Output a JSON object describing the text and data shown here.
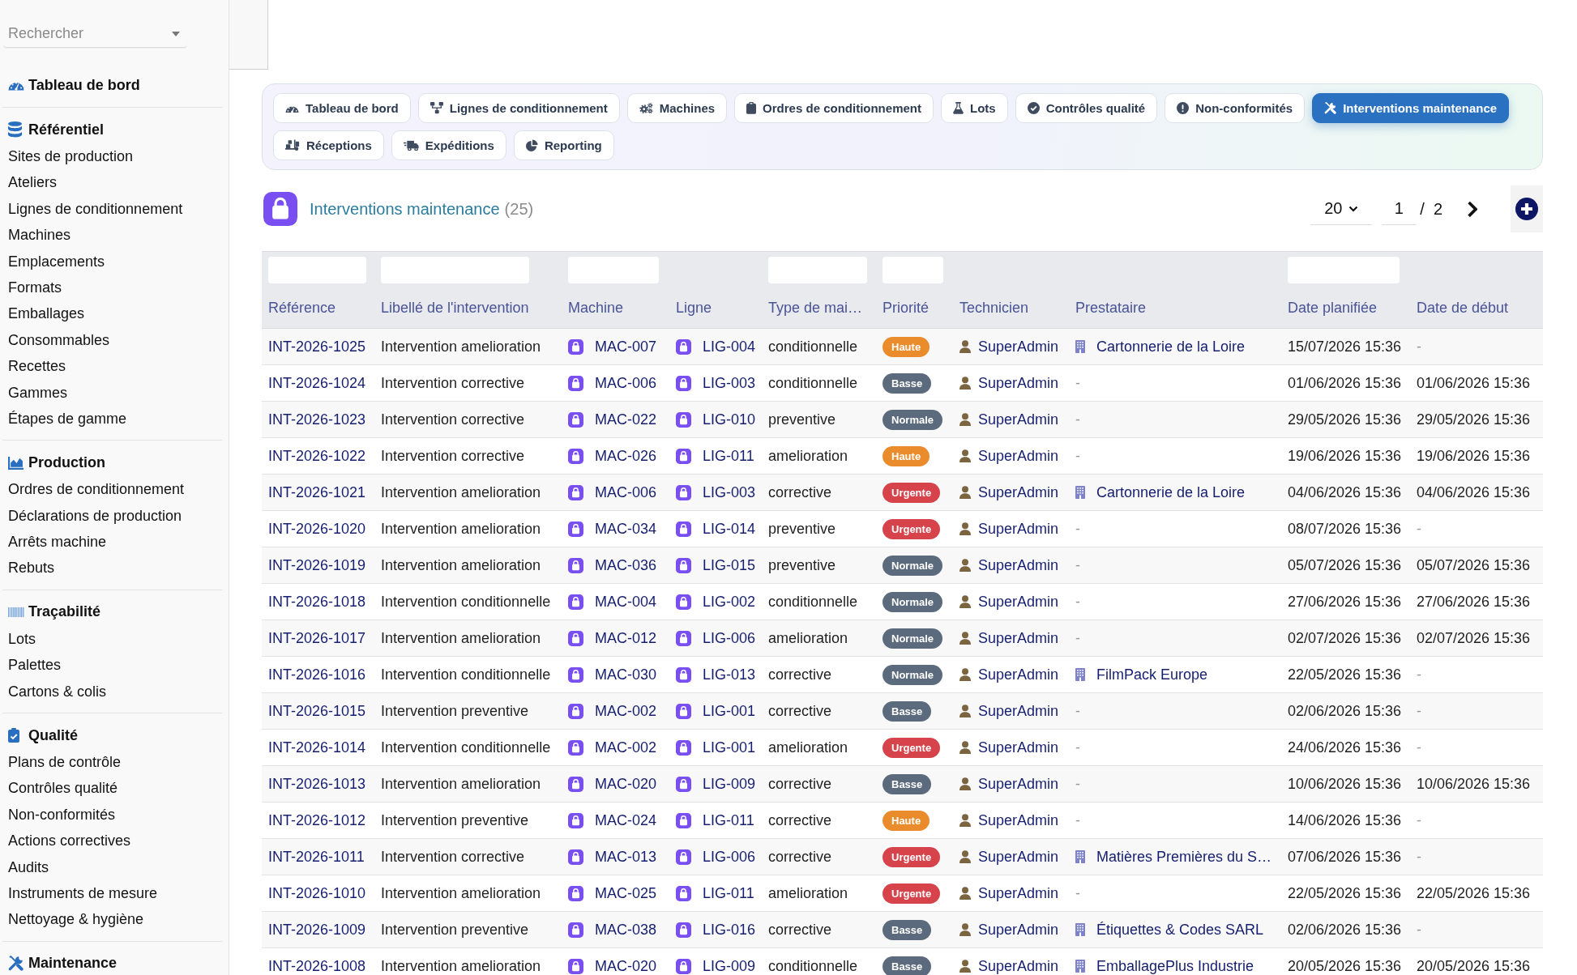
{
  "sidebar": {
    "search": {
      "placeholder": "Rechercher"
    },
    "sections": [
      {
        "title": "Tableau de bord"
      },
      {
        "title": "Référentiel",
        "items": [
          "Sites de production",
          "Ateliers",
          "Lignes de conditionnement",
          "Machines",
          "Emplacements",
          "Formats",
          "Emballages",
          "Consommables",
          "Recettes",
          "Gammes",
          "Étapes de gamme"
        ]
      },
      {
        "title": "Production",
        "items": [
          "Ordres de conditionnement",
          "Déclarations de production",
          "Arrêts machine",
          "Rebuts"
        ]
      },
      {
        "title": "Traçabilité",
        "items": [
          "Lots",
          "Palettes",
          "Cartons & colis"
        ]
      },
      {
        "title": "Qualité",
        "items": [
          "Plans de contrôle",
          "Contrôles qualité",
          "Non-conformités",
          "Actions correctives",
          "Audits",
          "Instruments de mesure",
          "Nettoyage & hygiène"
        ]
      },
      {
        "title": "Maintenance"
      }
    ]
  },
  "nav_tabs": [
    {
      "label": "Tableau de bord",
      "selected": false
    },
    {
      "label": "Lignes de conditionnement",
      "selected": false
    },
    {
      "label": "Machines",
      "selected": false
    },
    {
      "label": "Ordres de conditionnement",
      "selected": false
    },
    {
      "label": "Lots",
      "selected": false
    },
    {
      "label": "Contrôles qualité",
      "selected": false
    },
    {
      "label": "Non-conformités",
      "selected": false
    },
    {
      "label": "Interventions maintenance",
      "selected": true
    },
    {
      "label": "Réceptions",
      "selected": false
    },
    {
      "label": "Expéditions",
      "selected": false
    },
    {
      "label": "Reporting",
      "selected": false
    }
  ],
  "page": {
    "title": "Interventions maintenance",
    "count": "(25)"
  },
  "pagination": {
    "page_size": "20",
    "page": "1",
    "separator": "/",
    "page_count": "2"
  },
  "table": {
    "columns": [
      {
        "label": "Référence",
        "filter": true
      },
      {
        "label": "Libellé de l'intervention",
        "filter": true
      },
      {
        "label": "Machine",
        "filter": true
      },
      {
        "label": "Ligne",
        "filter": false
      },
      {
        "label": "Type de mai…",
        "filter": true
      },
      {
        "label": "Priorité",
        "filter": true
      },
      {
        "label": "Technicien",
        "filter": false
      },
      {
        "label": "Prestataire",
        "filter": false
      },
      {
        "label": "Date planifiée",
        "filter": true
      },
      {
        "label": "Date de début",
        "filter": false
      }
    ],
    "rows": [
      {
        "reference": "INT-2026-1025",
        "title": "Intervention amelioration",
        "machine": "MAC-007",
        "line": "LIG-004",
        "type": "conditionnelle",
        "priority": {
          "text": "Haute",
          "color": "#ea8c2c"
        },
        "technician": "SuperAdmin",
        "supplier": {
          "kind": "company",
          "text": "Cartonnerie de la Loire"
        },
        "planned": "15/07/2026 15:36",
        "start": {
          "kind": "empty",
          "text": "-"
        }
      },
      {
        "reference": "INT-2026-1024",
        "title": "Intervention corrective",
        "machine": "MAC-006",
        "line": "LIG-003",
        "type": "conditionnelle",
        "priority": {
          "text": "Basse",
          "color": "#5b6b7d"
        },
        "technician": "SuperAdmin",
        "supplier": {
          "kind": "empty",
          "text": "-"
        },
        "planned": "01/06/2026 15:36",
        "start": {
          "kind": "date",
          "text": "01/06/2026 15:36"
        }
      },
      {
        "reference": "INT-2026-1023",
        "title": "Intervention corrective",
        "machine": "MAC-022",
        "line": "LIG-010",
        "type": "preventive",
        "priority": {
          "text": "Normale",
          "color": "#5b6b7d"
        },
        "technician": "SuperAdmin",
        "supplier": {
          "kind": "empty",
          "text": "-"
        },
        "planned": "29/05/2026 15:36",
        "start": {
          "kind": "date",
          "text": "29/05/2026 15:36"
        }
      },
      {
        "reference": "INT-2026-1022",
        "title": "Intervention corrective",
        "machine": "MAC-026",
        "line": "LIG-011",
        "type": "amelioration",
        "priority": {
          "text": "Haute",
          "color": "#ea8c2c"
        },
        "technician": "SuperAdmin",
        "supplier": {
          "kind": "empty",
          "text": "-"
        },
        "planned": "19/06/2026 15:36",
        "start": {
          "kind": "date",
          "text": "19/06/2026 15:36"
        }
      },
      {
        "reference": "INT-2026-1021",
        "title": "Intervention amelioration",
        "machine": "MAC-006",
        "line": "LIG-003",
        "type": "corrective",
        "priority": {
          "text": "Urgente",
          "color": "#d6434b"
        },
        "technician": "SuperAdmin",
        "supplier": {
          "kind": "company",
          "text": "Cartonnerie de la Loire"
        },
        "planned": "04/06/2026 15:36",
        "start": {
          "kind": "date",
          "text": "04/06/2026 15:36"
        }
      },
      {
        "reference": "INT-2026-1020",
        "title": "Intervention amelioration",
        "machine": "MAC-034",
        "line": "LIG-014",
        "type": "preventive",
        "priority": {
          "text": "Urgente",
          "color": "#d6434b"
        },
        "technician": "SuperAdmin",
        "supplier": {
          "kind": "empty",
          "text": "-"
        },
        "planned": "08/07/2026 15:36",
        "start": {
          "kind": "empty",
          "text": "-"
        }
      },
      {
        "reference": "INT-2026-1019",
        "title": "Intervention amelioration",
        "machine": "MAC-036",
        "line": "LIG-015",
        "type": "preventive",
        "priority": {
          "text": "Normale",
          "color": "#5b6b7d"
        },
        "technician": "SuperAdmin",
        "supplier": {
          "kind": "empty",
          "text": "-"
        },
        "planned": "05/07/2026 15:36",
        "start": {
          "kind": "date",
          "text": "05/07/2026 15:36"
        }
      },
      {
        "reference": "INT-2026-1018",
        "title": "Intervention conditionnelle",
        "machine": "MAC-004",
        "line": "LIG-002",
        "type": "conditionnelle",
        "priority": {
          "text": "Normale",
          "color": "#5b6b7d"
        },
        "technician": "SuperAdmin",
        "supplier": {
          "kind": "empty",
          "text": "-"
        },
        "planned": "27/06/2026 15:36",
        "start": {
          "kind": "date",
          "text": "27/06/2026 15:36"
        }
      },
      {
        "reference": "INT-2026-1017",
        "title": "Intervention amelioration",
        "machine": "MAC-012",
        "line": "LIG-006",
        "type": "amelioration",
        "priority": {
          "text": "Normale",
          "color": "#5b6b7d"
        },
        "technician": "SuperAdmin",
        "supplier": {
          "kind": "empty",
          "text": "-"
        },
        "planned": "02/07/2026 15:36",
        "start": {
          "kind": "date",
          "text": "02/07/2026 15:36"
        }
      },
      {
        "reference": "INT-2026-1016",
        "title": "Intervention conditionnelle",
        "machine": "MAC-030",
        "line": "LIG-013",
        "type": "corrective",
        "priority": {
          "text": "Normale",
          "color": "#5b6b7d"
        },
        "technician": "SuperAdmin",
        "supplier": {
          "kind": "company",
          "text": "FilmPack Europe"
        },
        "planned": "22/05/2026 15:36",
        "start": {
          "kind": "empty",
          "text": "-"
        }
      },
      {
        "reference": "INT-2026-1015",
        "title": "Intervention preventive",
        "machine": "MAC-002",
        "line": "LIG-001",
        "type": "corrective",
        "priority": {
          "text": "Basse",
          "color": "#5b6b7d"
        },
        "technician": "SuperAdmin",
        "supplier": {
          "kind": "empty",
          "text": "-"
        },
        "planned": "02/06/2026 15:36",
        "start": {
          "kind": "empty",
          "text": "-"
        }
      },
      {
        "reference": "INT-2026-1014",
        "title": "Intervention conditionnelle",
        "machine": "MAC-002",
        "line": "LIG-001",
        "type": "amelioration",
        "priority": {
          "text": "Urgente",
          "color": "#d6434b"
        },
        "technician": "SuperAdmin",
        "supplier": {
          "kind": "empty",
          "text": "-"
        },
        "planned": "24/06/2026 15:36",
        "start": {
          "kind": "empty",
          "text": "-"
        }
      },
      {
        "reference": "INT-2026-1013",
        "title": "Intervention amelioration",
        "machine": "MAC-020",
        "line": "LIG-009",
        "type": "corrective",
        "priority": {
          "text": "Basse",
          "color": "#5b6b7d"
        },
        "technician": "SuperAdmin",
        "supplier": {
          "kind": "empty",
          "text": "-"
        },
        "planned": "10/06/2026 15:36",
        "start": {
          "kind": "date",
          "text": "10/06/2026 15:36"
        }
      },
      {
        "reference": "INT-2026-1012",
        "title": "Intervention preventive",
        "machine": "MAC-024",
        "line": "LIG-011",
        "type": "corrective",
        "priority": {
          "text": "Haute",
          "color": "#ea8c2c"
        },
        "technician": "SuperAdmin",
        "supplier": {
          "kind": "empty",
          "text": "-"
        },
        "planned": "14/06/2026 15:36",
        "start": {
          "kind": "empty",
          "text": "-"
        }
      },
      {
        "reference": "INT-2026-1011",
        "title": "Intervention corrective",
        "machine": "MAC-013",
        "line": "LIG-006",
        "type": "corrective",
        "priority": {
          "text": "Urgente",
          "color": "#d6434b"
        },
        "technician": "SuperAdmin",
        "supplier": {
          "kind": "company",
          "text": "Matières Premières du S…"
        },
        "planned": "07/06/2026 15:36",
        "start": {
          "kind": "empty",
          "text": "-"
        }
      },
      {
        "reference": "INT-2026-1010",
        "title": "Intervention amelioration",
        "machine": "MAC-025",
        "line": "LIG-011",
        "type": "amelioration",
        "priority": {
          "text": "Urgente",
          "color": "#d6434b"
        },
        "technician": "SuperAdmin",
        "supplier": {
          "kind": "empty",
          "text": "-"
        },
        "planned": "22/05/2026 15:36",
        "start": {
          "kind": "date",
          "text": "22/05/2026 15:36"
        }
      },
      {
        "reference": "INT-2026-1009",
        "title": "Intervention preventive",
        "machine": "MAC-038",
        "line": "LIG-016",
        "type": "corrective",
        "priority": {
          "text": "Basse",
          "color": "#5b6b7d"
        },
        "technician": "SuperAdmin",
        "supplier": {
          "kind": "company",
          "text": "Étiquettes & Codes SARL"
        },
        "planned": "02/06/2026 15:36",
        "start": {
          "kind": "empty",
          "text": "-"
        }
      },
      {
        "reference": "INT-2026-1008",
        "title": "Intervention amelioration",
        "machine": "MAC-020",
        "line": "LIG-009",
        "type": "conditionnelle",
        "priority": {
          "text": "Basse",
          "color": "#5b6b7d"
        },
        "technician": "SuperAdmin",
        "supplier": {
          "kind": "company",
          "text": "EmballagePlus Industrie"
        },
        "planned": "20/05/2026 15:36",
        "start": {
          "kind": "date",
          "text": "20/05/2026 15:36"
        }
      }
    ]
  }
}
